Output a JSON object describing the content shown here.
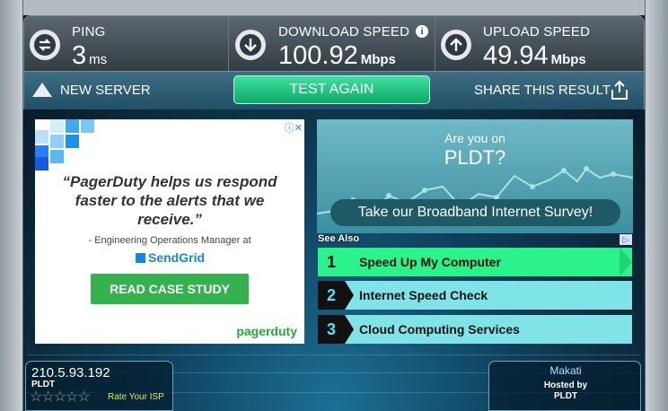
{
  "metrics": {
    "ping": {
      "label": "PING",
      "value": "3",
      "unit": "ms"
    },
    "download": {
      "label": "DOWNLOAD SPEED",
      "value": "100.92",
      "unit": "Mbps"
    },
    "upload": {
      "label": "UPLOAD SPEED",
      "value": "49.94",
      "unit": "Mbps"
    }
  },
  "actions": {
    "new_server": "NEW SERVER",
    "test_again": "TEST AGAIN",
    "share": "SHARE THIS RESULT"
  },
  "ad_left": {
    "quote": "“PagerDuty helps us respond faster to the alerts that we receive.”",
    "attribution": "- Engineering Operations Manager at",
    "company": "SendGrid",
    "cta": "READ CASE STUDY",
    "brand": "pagerduty"
  },
  "survey": {
    "line1": "Are you on",
    "line2": "PLDT?",
    "button": "Take our Broadband Internet Survey!"
  },
  "see_also": {
    "label": "See Also",
    "items": [
      {
        "num": "1",
        "text": "Speed Up My Computer"
      },
      {
        "num": "2",
        "text": "Internet Speed Check"
      },
      {
        "num": "3",
        "text": "Cloud Computing Services"
      }
    ]
  },
  "isp": {
    "ip": "210.5.93.192",
    "name": "PLDT",
    "stars": "☆☆☆☆☆",
    "rate_label": "Rate Your ISP"
  },
  "host": {
    "city": "Makati",
    "hosted_by": "Hosted by",
    "isp": "PLDT"
  },
  "colors": {
    "accent_green": "#2bf28a",
    "cta_green": "#35b14f",
    "link_blue": "#7fe3e8"
  }
}
